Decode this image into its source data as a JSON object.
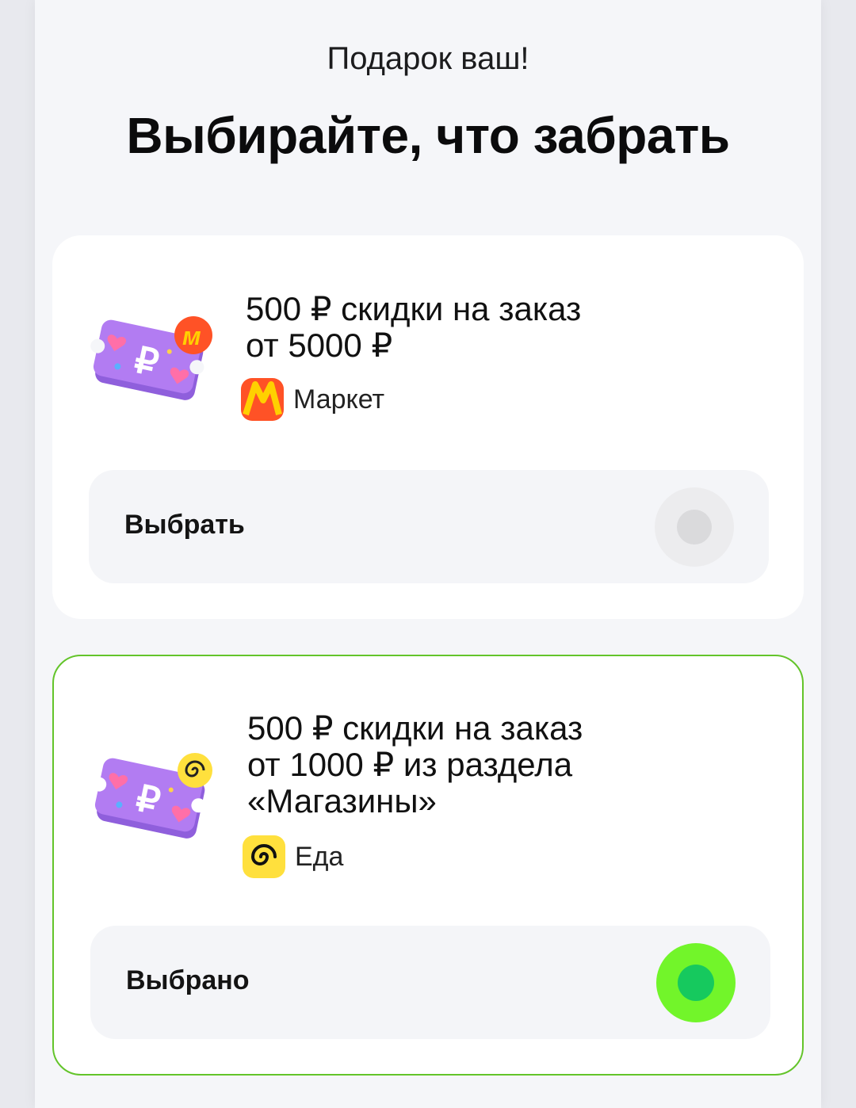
{
  "header": {
    "subtitle": "Подарок ваш!",
    "title": "Выбирайте, что забрать"
  },
  "offers": [
    {
      "line1": "500 ₽ скидки на заказ",
      "line2": "от 5000 ₽",
      "line3": "",
      "brand": "Маркет",
      "brand_icon": "market-logo-icon",
      "action_label": "Выбрать",
      "selected": false
    },
    {
      "line1": "500 ₽ скидки на заказ",
      "line2": "от 1000 ₽ из раздела",
      "line3": "«Магазины»",
      "brand": "Еда",
      "brand_icon": "eda-logo-icon",
      "action_label": "Выбрано",
      "selected": true
    }
  ],
  "colors": {
    "selected_border": "#63c42a",
    "radio_on_outer": "#72f52a",
    "radio_on_inner": "#16c95e",
    "market_logo": "#ff5226",
    "eda_logo": "#ffe03d",
    "coupon": "#b27cf2"
  }
}
